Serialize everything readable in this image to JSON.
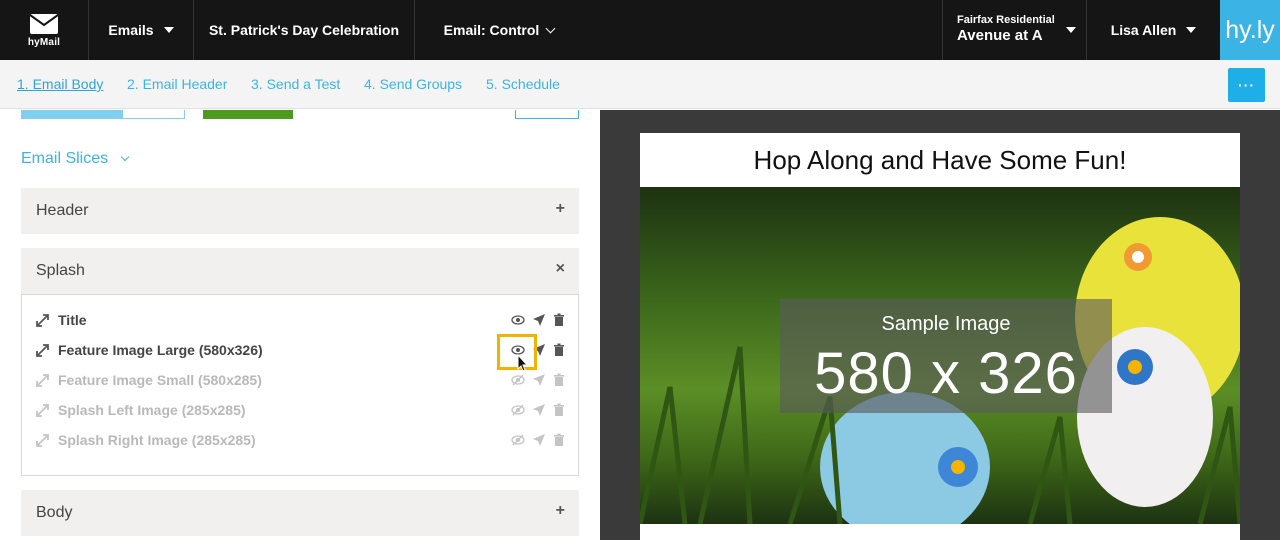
{
  "topbar": {
    "logo_text": "hyMail",
    "emails_label": "Emails",
    "campaign_label": "St. Patrick's Day Celebration",
    "variant_label": "Email: Control",
    "property_company": "Fairfax Residential",
    "property_name": "Avenue at A",
    "user_name": "Lisa Allen",
    "brand": "hy.ly"
  },
  "steps": [
    {
      "label": "1. Email Body",
      "active": true
    },
    {
      "label": "2. Email Header"
    },
    {
      "label": "3. Send a Test"
    },
    {
      "label": "4. Send Groups"
    },
    {
      "label": "5. Schedule"
    }
  ],
  "more_button_label": "···",
  "left": {
    "slices_label": "Email Slices",
    "sections": {
      "header": {
        "label": "Header",
        "icon": "+"
      },
      "splash": {
        "label": "Splash",
        "icon": "×"
      },
      "body": {
        "label": "Body",
        "icon": "+"
      }
    },
    "splash_items": [
      {
        "label": "Title",
        "enabled": true
      },
      {
        "label": "Feature Image Large (580x326)",
        "enabled": true
      },
      {
        "label": "Feature Image Small (580x285)",
        "enabled": false
      },
      {
        "label": "Splash Left Image (285x285)",
        "enabled": false
      },
      {
        "label": "Splash Right Image (285x285)",
        "enabled": false
      }
    ]
  },
  "preview": {
    "title": "Hop Along and Have Some Fun!",
    "image_caption": "Sample Image",
    "image_size": "580 x 326"
  },
  "colors": {
    "accent": "#3bb4e5",
    "topbar_bg": "#151515",
    "highlight": "#f2b300",
    "green_button": "#4d9b1e"
  }
}
